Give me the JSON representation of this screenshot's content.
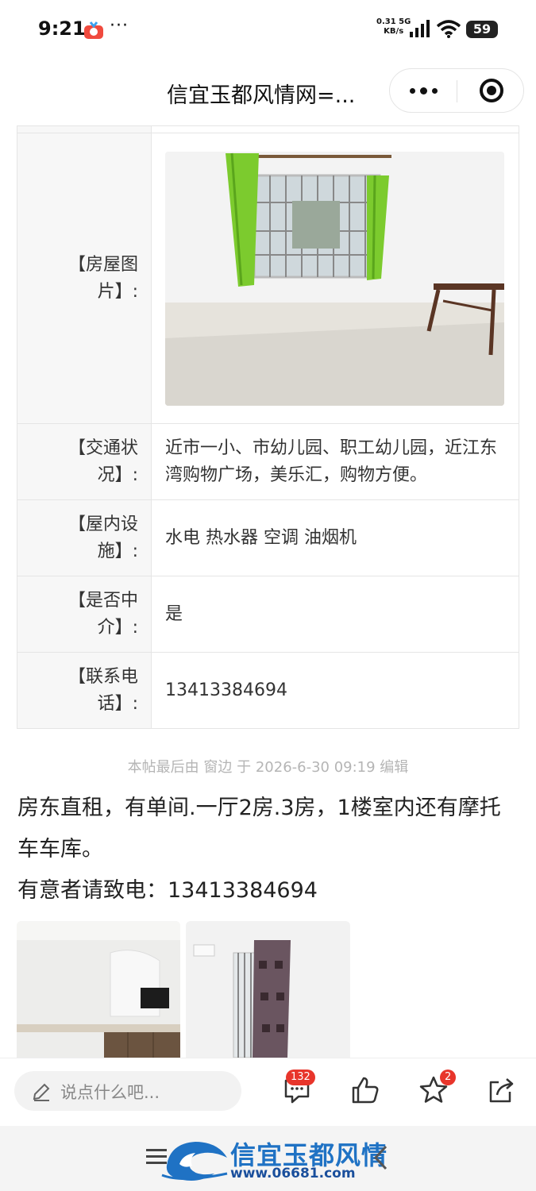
{
  "status_bar": {
    "time": "9:21",
    "dots": "···",
    "net_speed": "0.31",
    "net_type": "5G",
    "net_unit": "KB/s",
    "battery": "59"
  },
  "title_bar": {
    "title": "信宜玉都风情网=..."
  },
  "info_table": {
    "rows": [
      {
        "label": "【房屋图片】:"
      },
      {
        "label": "【交通状况】:",
        "value": "近市一小、市幼儿园、职工幼儿园，近江东湾购物广场，美乐汇，购物方便。"
      },
      {
        "label": "【屋内设施】:",
        "value": "水电 热水器 空调 油烟机"
      },
      {
        "label": "【是否中介】:",
        "value": "是"
      },
      {
        "label": "【联系电话】:",
        "value": "13413384694"
      }
    ]
  },
  "post": {
    "edit_note": "本帖最后由 窗边 于 2026-6-30 09:19 编辑",
    "line1": "房东直租，有单间.一厅2房.3房，1楼室内还有摩托车车库。",
    "line2": "有意者请致电：13413384694"
  },
  "action_bar": {
    "comment_placeholder": "说点什么吧...",
    "comment_count": "132",
    "favorite_count": "2"
  },
  "footer": {
    "site_name": "信宜玉都风情",
    "site_url": "www.06681.com"
  },
  "colors": {
    "accent_red": "#e8352b",
    "brand_blue": "#1f72c4"
  }
}
